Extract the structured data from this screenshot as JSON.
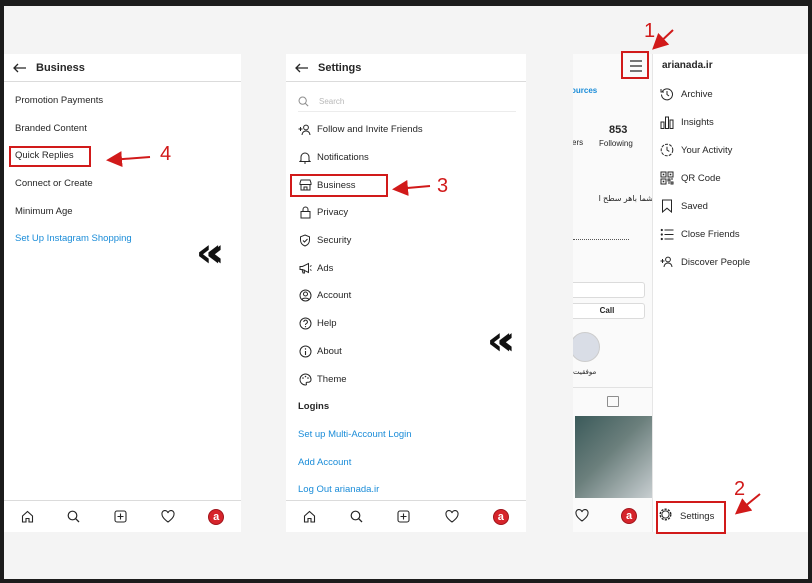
{
  "business": {
    "title": "Business",
    "items": [
      {
        "label": "Promotion Payments"
      },
      {
        "label": "Branded Content"
      },
      {
        "label": "Quick Replies"
      },
      {
        "label": "Connect or Create"
      },
      {
        "label": "Minimum Age"
      },
      {
        "label": "Set Up Instagram Shopping",
        "link": true
      }
    ]
  },
  "settings": {
    "title": "Settings",
    "search_placeholder": "Search",
    "items": [
      {
        "label": "Follow and Invite Friends",
        "icon": "add-person-icon"
      },
      {
        "label": "Notifications",
        "icon": "bell-icon"
      },
      {
        "label": "Business",
        "icon": "shop-icon"
      },
      {
        "label": "Privacy",
        "icon": "lock-icon"
      },
      {
        "label": "Security",
        "icon": "shield-icon"
      },
      {
        "label": "Ads",
        "icon": "megaphone-icon"
      },
      {
        "label": "Account",
        "icon": "account-icon"
      },
      {
        "label": "Help",
        "icon": "help-icon"
      },
      {
        "label": "About",
        "icon": "info-icon"
      },
      {
        "label": "Theme",
        "icon": "palette-icon"
      }
    ],
    "logins_header": "Logins",
    "login_links": [
      "Set up Multi-Account Login",
      "Add Account",
      "Log Out arianada.ir"
    ]
  },
  "profile": {
    "resources_label": "ources",
    "stat_partial_label": "ers",
    "following_count": "853",
    "following_label": "Following",
    "bio_text": "شما باهر سطح ا",
    "call_button": "Call",
    "highlight_label": "موفقیت"
  },
  "drawer": {
    "username": "arianada.ir",
    "items": [
      {
        "label": "Archive",
        "icon": "archive-icon"
      },
      {
        "label": "Insights",
        "icon": "insights-icon"
      },
      {
        "label": "Your Activity",
        "icon": "activity-icon"
      },
      {
        "label": "QR Code",
        "icon": "qr-icon"
      },
      {
        "label": "Saved",
        "icon": "bookmark-icon"
      },
      {
        "label": "Close Friends",
        "icon": "list-icon"
      },
      {
        "label": "Discover People",
        "icon": "add-person-icon"
      }
    ],
    "settings_label": "Settings"
  },
  "annotations": {
    "step1": "1",
    "step2": "2",
    "step3": "3",
    "step4": "4",
    "color": "#d11a1a"
  },
  "bottom_nav_avatar": "a"
}
